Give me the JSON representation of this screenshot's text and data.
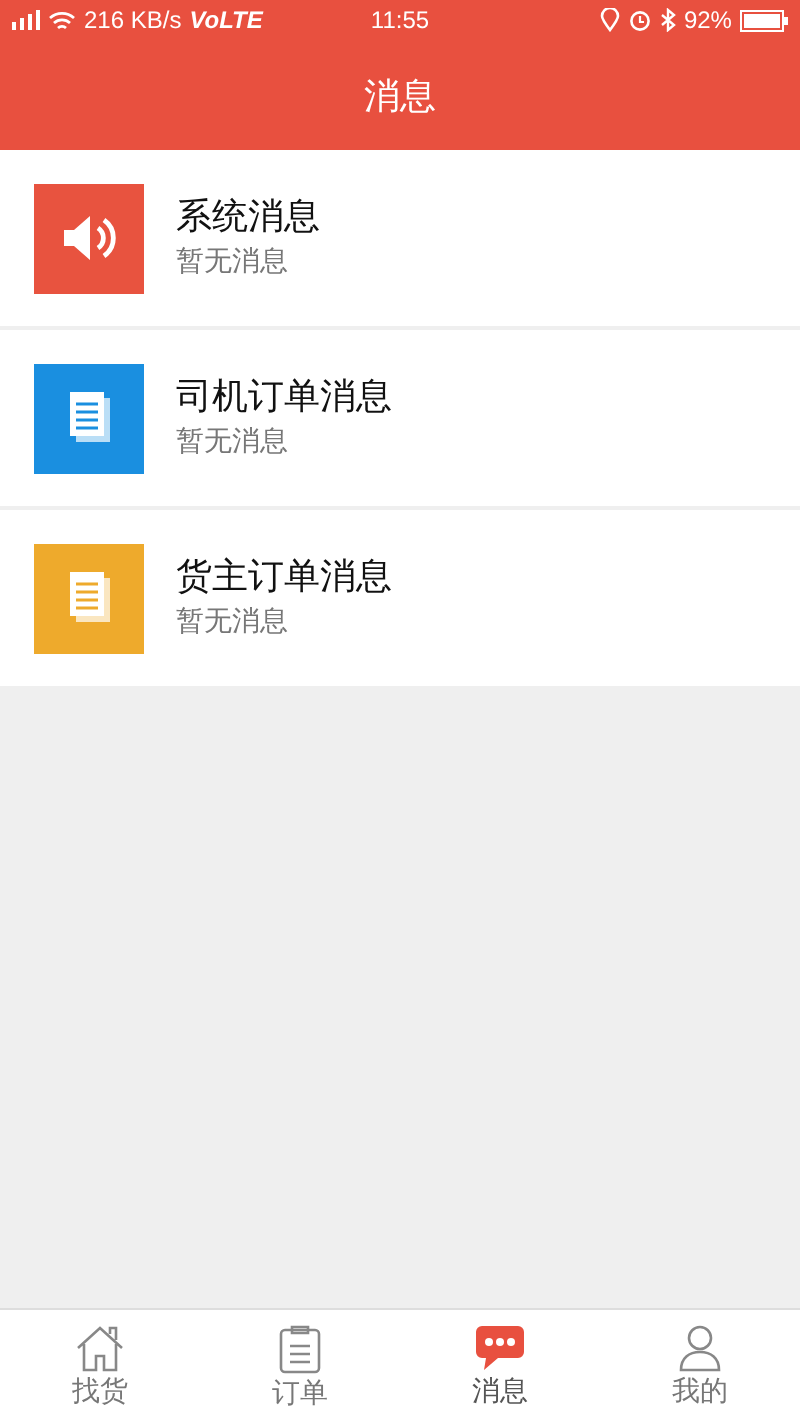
{
  "status_bar": {
    "speed": "216 KB/s",
    "network": "VoLTE",
    "time": "11:55",
    "battery": "92%"
  },
  "header": {
    "title": "消息"
  },
  "messages": [
    {
      "title": "系统消息",
      "subtitle": "暂无消息",
      "kind": "speaker",
      "color": "#e8533f"
    },
    {
      "title": "司机订单消息",
      "subtitle": "暂无消息",
      "kind": "document",
      "color": "#1a8fe0"
    },
    {
      "title": "货主订单消息",
      "subtitle": "暂无消息",
      "kind": "document",
      "color": "#eeaa2c"
    }
  ],
  "nav": [
    {
      "label": "找货",
      "kind": "home",
      "selected": false
    },
    {
      "label": "订单",
      "kind": "clipboard",
      "selected": false
    },
    {
      "label": "消息",
      "kind": "chat",
      "selected": true
    },
    {
      "label": "我的",
      "kind": "person",
      "selected": false
    }
  ]
}
